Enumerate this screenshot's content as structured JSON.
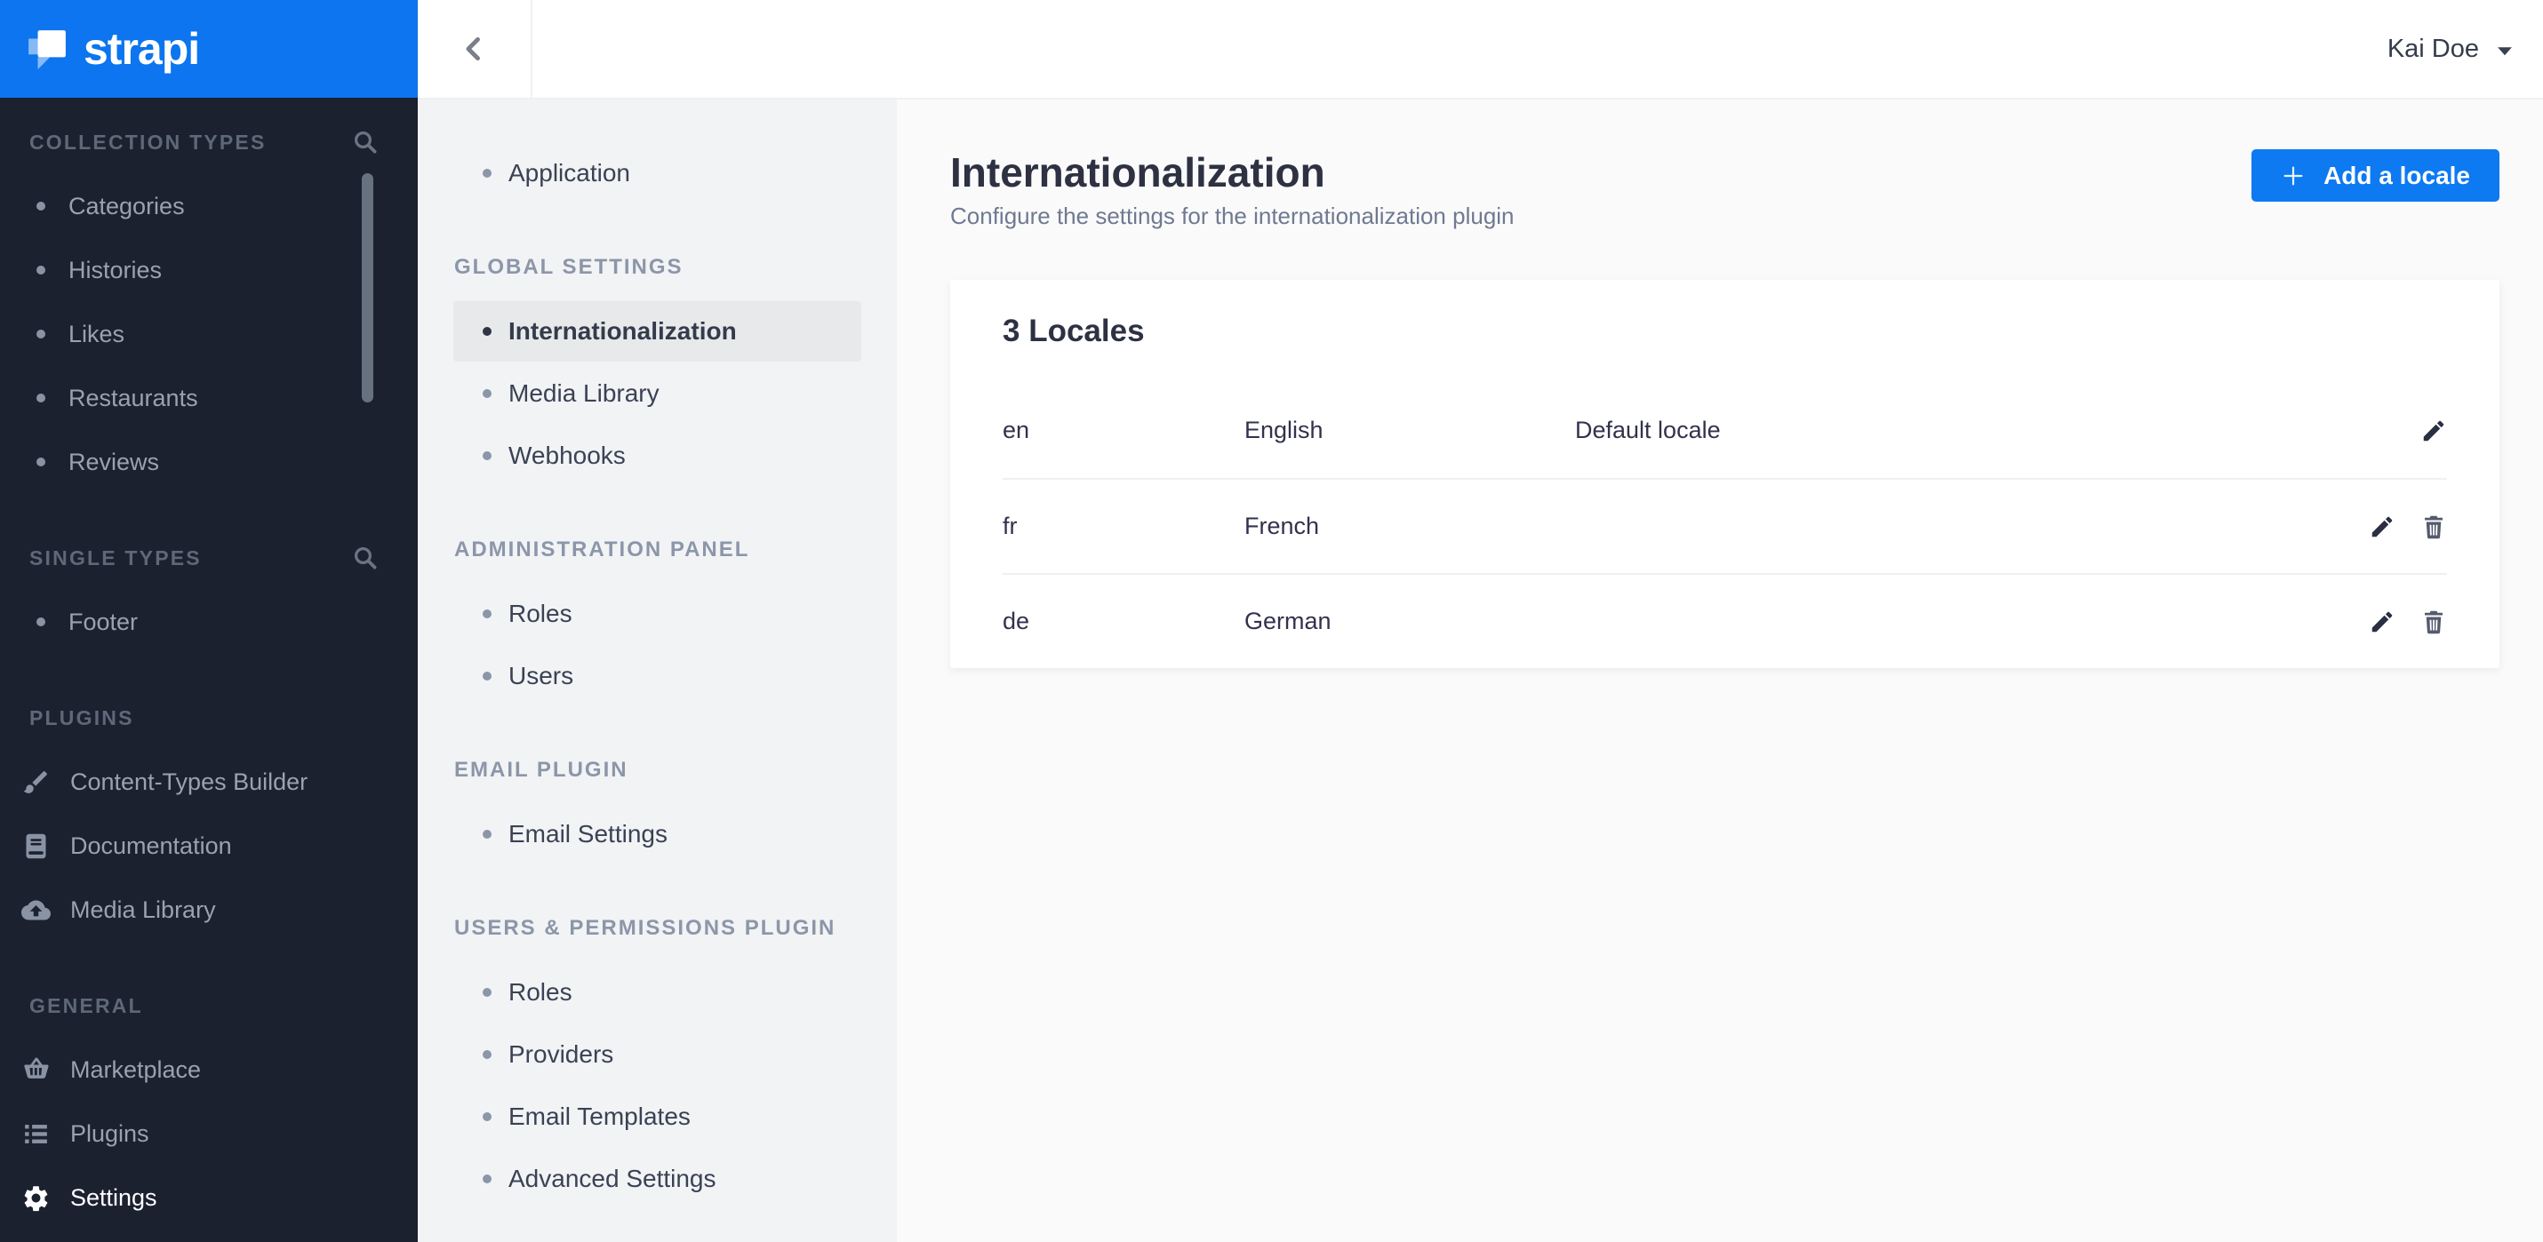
{
  "colors": {
    "accent_blue": "#0D7AF2",
    "logo_blue": "#0C75EF",
    "sidebar_dark": "#1B212F"
  },
  "brand": {
    "name": "strapi"
  },
  "topbar": {
    "back_icon": "chevron-left-icon",
    "user": {
      "name": "Kai Doe",
      "menu_icon": "caret-down-icon"
    }
  },
  "nav": {
    "sections": [
      {
        "label": "COLLECTION TYPES",
        "search_icon": "search-icon",
        "items": [
          {
            "label": "Categories"
          },
          {
            "label": "Histories"
          },
          {
            "label": "Likes"
          },
          {
            "label": "Restaurants"
          },
          {
            "label": "Reviews"
          }
        ]
      },
      {
        "label": "SINGLE TYPES",
        "search_icon": "search-icon",
        "items": [
          {
            "label": "Footer"
          }
        ]
      },
      {
        "label": "PLUGINS",
        "items": [
          {
            "label": "Content-Types Builder",
            "icon": "paintbrush-icon"
          },
          {
            "label": "Documentation",
            "icon": "book-icon"
          },
          {
            "label": "Media Library",
            "icon": "cloud-upload-icon"
          }
        ]
      },
      {
        "label": "GENERAL",
        "items": [
          {
            "label": "Marketplace",
            "icon": "basket-icon"
          },
          {
            "label": "Plugins",
            "icon": "list-icon"
          },
          {
            "label": "Settings",
            "icon": "gear-icon",
            "active": true
          }
        ]
      }
    ]
  },
  "settings_nav": {
    "root_items": [
      {
        "label": "Application"
      }
    ],
    "sections": [
      {
        "label": "GLOBAL SETTINGS",
        "items": [
          {
            "label": "Internationalization",
            "selected": true
          },
          {
            "label": "Media Library"
          },
          {
            "label": "Webhooks"
          }
        ]
      },
      {
        "label": "ADMINISTRATION PANEL",
        "items": [
          {
            "label": "Roles"
          },
          {
            "label": "Users"
          }
        ]
      },
      {
        "label": "EMAIL PLUGIN",
        "items": [
          {
            "label": "Email Settings"
          }
        ]
      },
      {
        "label": "USERS & PERMISSIONS PLUGIN",
        "items": [
          {
            "label": "Roles"
          },
          {
            "label": "Providers"
          },
          {
            "label": "Email Templates"
          },
          {
            "label": "Advanced Settings"
          }
        ]
      }
    ]
  },
  "main": {
    "page_title": "Internationalization",
    "page_subtitle": "Configure the settings for the internationalization plugin",
    "add_locale_button": {
      "label": "Add a locale",
      "icon": "plus-icon"
    },
    "locales_card": {
      "title": "3 Locales",
      "rows": [
        {
          "code": "en",
          "name": "English",
          "note": "Default locale",
          "deletable": false
        },
        {
          "code": "fr",
          "name": "French",
          "note": "",
          "deletable": true
        },
        {
          "code": "de",
          "name": "German",
          "note": "",
          "deletable": true
        }
      ]
    }
  }
}
